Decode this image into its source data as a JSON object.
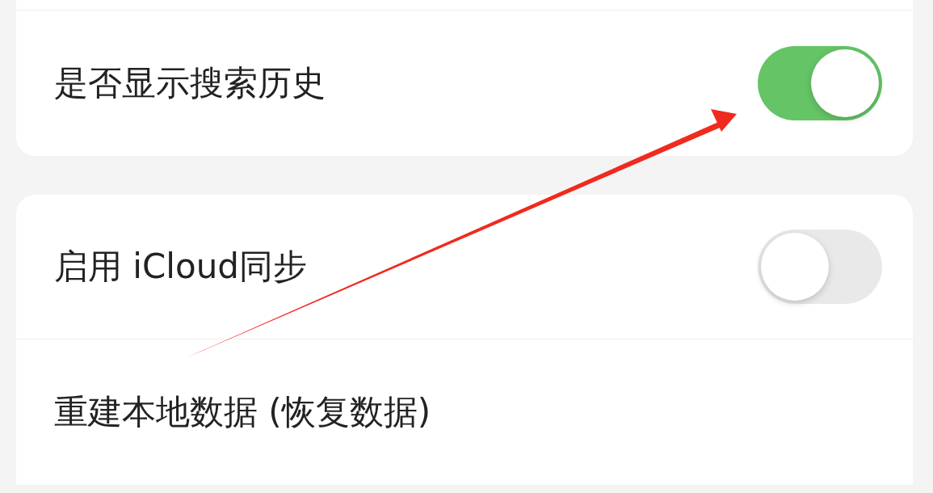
{
  "groups": [
    {
      "rows": [
        {
          "label": "是否显示搜索历史",
          "kind": "toggle",
          "on": true
        }
      ]
    },
    {
      "rows": [
        {
          "label": "启用 iCloud同步",
          "kind": "toggle",
          "on": false
        },
        {
          "label": "重建本地数据 (恢复数据)",
          "kind": "action"
        }
      ]
    }
  ]
}
